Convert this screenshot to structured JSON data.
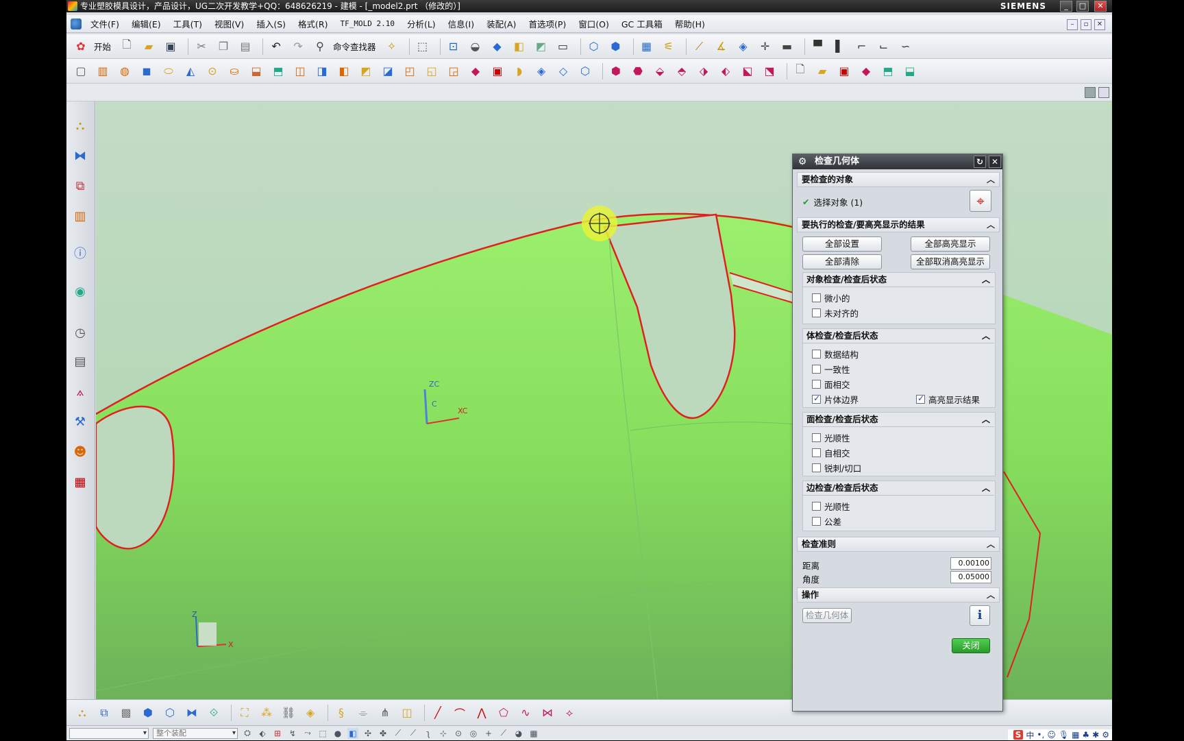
{
  "window": {
    "title": "专业塑胶模具设计，产品设计，UG二次开发教学+QQ：648626219 - 建模 - [_model2.prt （修改的）]",
    "brand": "SIEMENS"
  },
  "menu": {
    "items": [
      "文件(F)",
      "编辑(E)",
      "工具(T)",
      "视图(V)",
      "插入(S)",
      "格式(R)",
      "TF_MOLD 2.10",
      "分析(L)",
      "信息(I)",
      "装配(A)",
      "首选项(P)",
      "窗口(O)",
      "GC 工具箱",
      "帮助(H)"
    ]
  },
  "toolbar": {
    "start_label": "开始",
    "command_finder_label": "命令查找器"
  },
  "viewport": {
    "csys_labels": {
      "zc": "ZC",
      "xc": "XC",
      "c": "C"
    },
    "triad_labels": {
      "z": "Z",
      "x": "X"
    },
    "colors": {
      "surface": "#8fe46a",
      "edge": "#e02020",
      "background": "#bcd9be"
    }
  },
  "dialog": {
    "title": "检查几何体",
    "sections": {
      "objects": {
        "header": "要检查的对象",
        "select_label": "选择对象 (1)"
      },
      "checks": {
        "header": "要执行的检查/要高亮显示的结果",
        "buttons": {
          "set_all": "全部设置",
          "highlight_all": "全部高亮显示",
          "clear_all": "全部清除",
          "unhighlight_all": "全部取消高亮显示"
        },
        "object_checks": {
          "header": "对象检查/检查后状态",
          "items": [
            {
              "label": "微小的",
              "checked": false
            },
            {
              "label": "未对齐的",
              "checked": false
            }
          ]
        },
        "body_checks": {
          "header": "体检查/检查后状态",
          "items": [
            {
              "label": "数据结构",
              "checked": false
            },
            {
              "label": "一致性",
              "checked": false
            },
            {
              "label": "面相交",
              "checked": false
            },
            {
              "label": "片体边界",
              "checked": true
            }
          ],
          "highlight_label": "高亮显示结果",
          "highlight_checked": true
        },
        "face_checks": {
          "header": "面检查/检查后状态",
          "items": [
            {
              "label": "光顺性",
              "checked": false
            },
            {
              "label": "自相交",
              "checked": false
            },
            {
              "label": "锐刺/切口",
              "checked": false
            }
          ]
        },
        "edge_checks": {
          "header": "边检查/检查后状态",
          "items": [
            {
              "label": "光顺性",
              "checked": false
            },
            {
              "label": "公差",
              "checked": false
            }
          ]
        }
      },
      "criteria": {
        "header": "检查准则",
        "distance_label": "距离",
        "distance_value": "0.00100",
        "angle_label": "角度",
        "angle_value": "0.05000"
      },
      "operation": {
        "header": "操作",
        "check_button": "检查几何体"
      }
    },
    "close_button": "关闭"
  },
  "statusbar": {
    "filter_value": "",
    "assembly_select": "整个装配"
  },
  "tray": {
    "lang": "中"
  }
}
